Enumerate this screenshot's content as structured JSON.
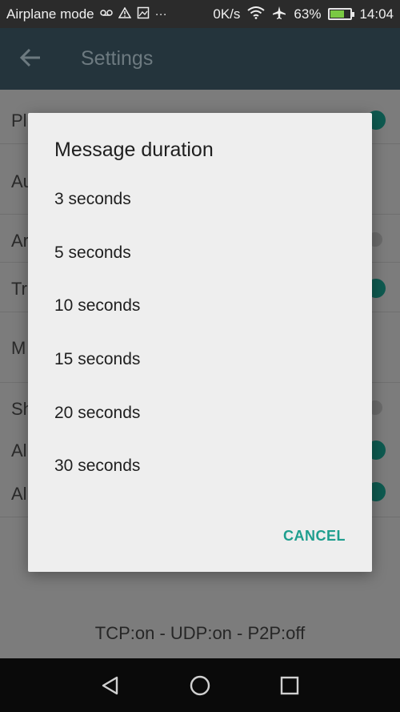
{
  "status_bar": {
    "mode_label": "Airplane mode",
    "network_speed": "0K/s",
    "battery_percent": "63%",
    "battery_level": 0.63,
    "time": "14:04",
    "icons": [
      "voicemail-icon",
      "warning-icon",
      "image-icon",
      "more-icon",
      "wifi-icon",
      "airplane-icon",
      "battery-icon"
    ]
  },
  "app_bar": {
    "title": "Settings",
    "back_icon": "back-arrow-icon"
  },
  "settings_list": {
    "visible_fragments": [
      "Pl",
      "Au",
      "Ar",
      "Tr",
      "M",
      "Sh",
      "Al",
      "Al"
    ]
  },
  "footer": {
    "status_text": "TCP:on - UDP:on - P2P:off"
  },
  "dialog": {
    "title": "Message duration",
    "options": [
      "3 seconds",
      "5 seconds",
      "10 seconds",
      "15 seconds",
      "20 seconds",
      "30 seconds"
    ],
    "cancel_label": "CANCEL",
    "accent_color": "#1e9e8e"
  },
  "nav_bar": {
    "icons": [
      "back-triangle-icon",
      "home-circle-icon",
      "recents-square-icon"
    ]
  }
}
